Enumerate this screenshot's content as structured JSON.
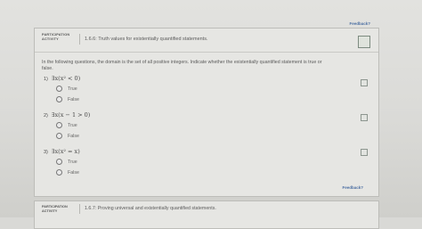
{
  "feedback_top": "Feedback?",
  "activity": {
    "label_line1": "PARTICIPATION",
    "label_line2": "ACTIVITY",
    "title": "1.6.6: Truth values for existentially quantified statements."
  },
  "intro": "In the following questions, the domain is the set of all positive integers. Indicate whether the existentially quantified statement is true or false.",
  "questions": [
    {
      "number": "1)",
      "statement": "∃x(x² < 0)",
      "options": [
        "True",
        "False"
      ]
    },
    {
      "number": "2)",
      "statement": "∃x(x − 1 > 0)",
      "options": [
        "True",
        "False"
      ]
    },
    {
      "number": "3)",
      "statement": "∃x(x² = x)",
      "options": [
        "True",
        "False"
      ]
    }
  ],
  "feedback_bottom": "Feedback?",
  "next_activity": {
    "label_line1": "PARTICIPATION",
    "label_line2": "ACTIVITY",
    "title": "1.6.7: Proving universal and existentially quantified statements."
  }
}
